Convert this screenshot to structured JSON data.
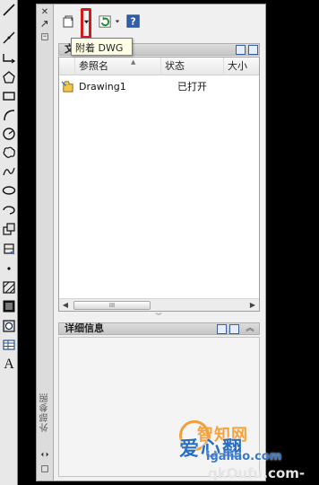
{
  "toolbar_tools": [
    "line-tool-icon",
    "construction-line-tool-icon",
    "polyline-tool-icon",
    "polygon-tool-icon",
    "rectangle-tool-icon",
    "arc-tool-icon",
    "circle-tool-icon",
    "revision-cloud-tool-icon",
    "spline-tool-icon",
    "ellipse-tool-icon",
    "ellipse-arc-tool-icon",
    "insert-block-tool-icon",
    "make-block-tool-icon",
    "point-tool-icon",
    "hatch-tool-icon",
    "gradient-tool-icon",
    "region-tool-icon",
    "table-tool-icon"
  ],
  "toolbar_text_tool": "A",
  "palette": {
    "close_glyph": "✕",
    "vertical_title": "外部参照",
    "tooltip": "附着 DWG",
    "file_refs": {
      "title": "文",
      "columns": [
        "参照名",
        "状态",
        "大小"
      ],
      "rows": [
        {
          "name": "Drawing1",
          "status": "已打开",
          "size": ""
        }
      ],
      "scroll_left": "◀",
      "scroll_right": "▶",
      "scroll_thumb": "III"
    },
    "details": {
      "title": "详细信息",
      "chevron": "︽"
    },
    "splitter_glyph": "︾"
  },
  "watermark": {
    "line1": "智知网",
    "line2": "爱心翻",
    "line3": "igaliao.com",
    "line4": "qkOufu.com-"
  },
  "colors": {
    "accent_red": "#d21a1a",
    "tooltip_bg": "#ffffe7",
    "watermark_orange": "#f5a23c",
    "watermark_blue": "#2a6fc4"
  }
}
